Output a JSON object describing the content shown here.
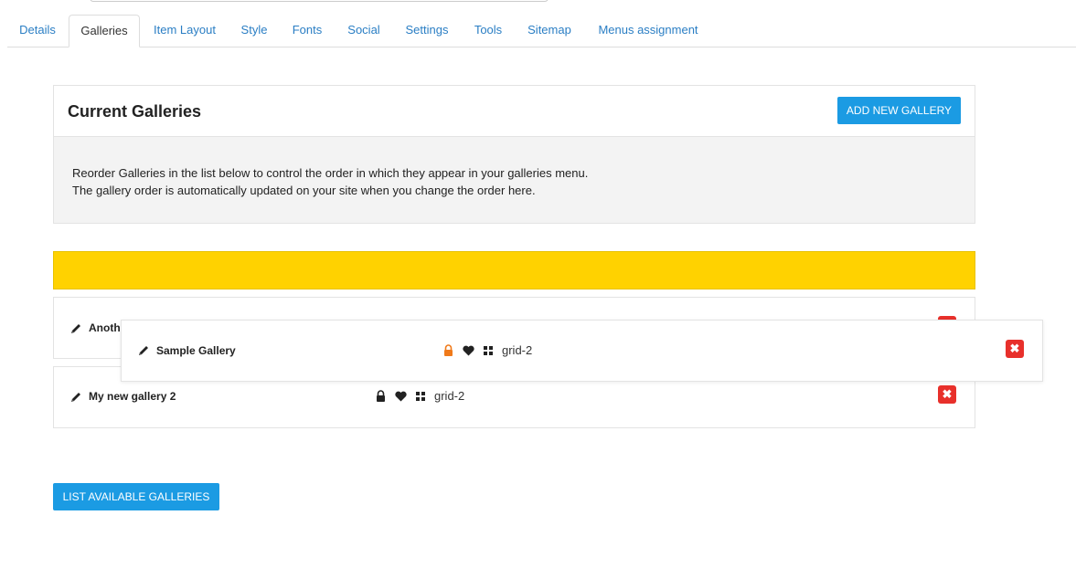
{
  "tabs": [
    {
      "label": "Details"
    },
    {
      "label": "Galleries"
    },
    {
      "label": "Item Layout"
    },
    {
      "label": "Style"
    },
    {
      "label": "Fonts"
    },
    {
      "label": "Social"
    },
    {
      "label": "Settings"
    },
    {
      "label": "Tools"
    },
    {
      "label": "Sitemap"
    },
    {
      "label": "Menus assignment"
    }
  ],
  "active_tab": "Galleries",
  "panel": {
    "title": "Current Galleries",
    "add_button": "ADD NEW GALLERY",
    "description_line1": "Reorder Galleries in the list below to control the order in which they appear in your galleries menu.",
    "description_line2": "The gallery order is automatically updated on your site when you change the order here."
  },
  "galleries": [
    {
      "name": "Anothe",
      "layout": "",
      "locked": false
    },
    {
      "name": "My new gallery 2",
      "layout": "grid-2",
      "locked": true
    }
  ],
  "dragging": {
    "name": "Sample Gallery",
    "layout": "grid-2",
    "lock_color": "#f07a1a"
  },
  "delete_glyph": "✖",
  "list_button": "LIST AVAILABLE GALLERIES",
  "colors": {
    "accent": "#1b9be3",
    "placeholder": "#ffd200",
    "delete": "#e8302b",
    "link": "#2a7ec4"
  }
}
